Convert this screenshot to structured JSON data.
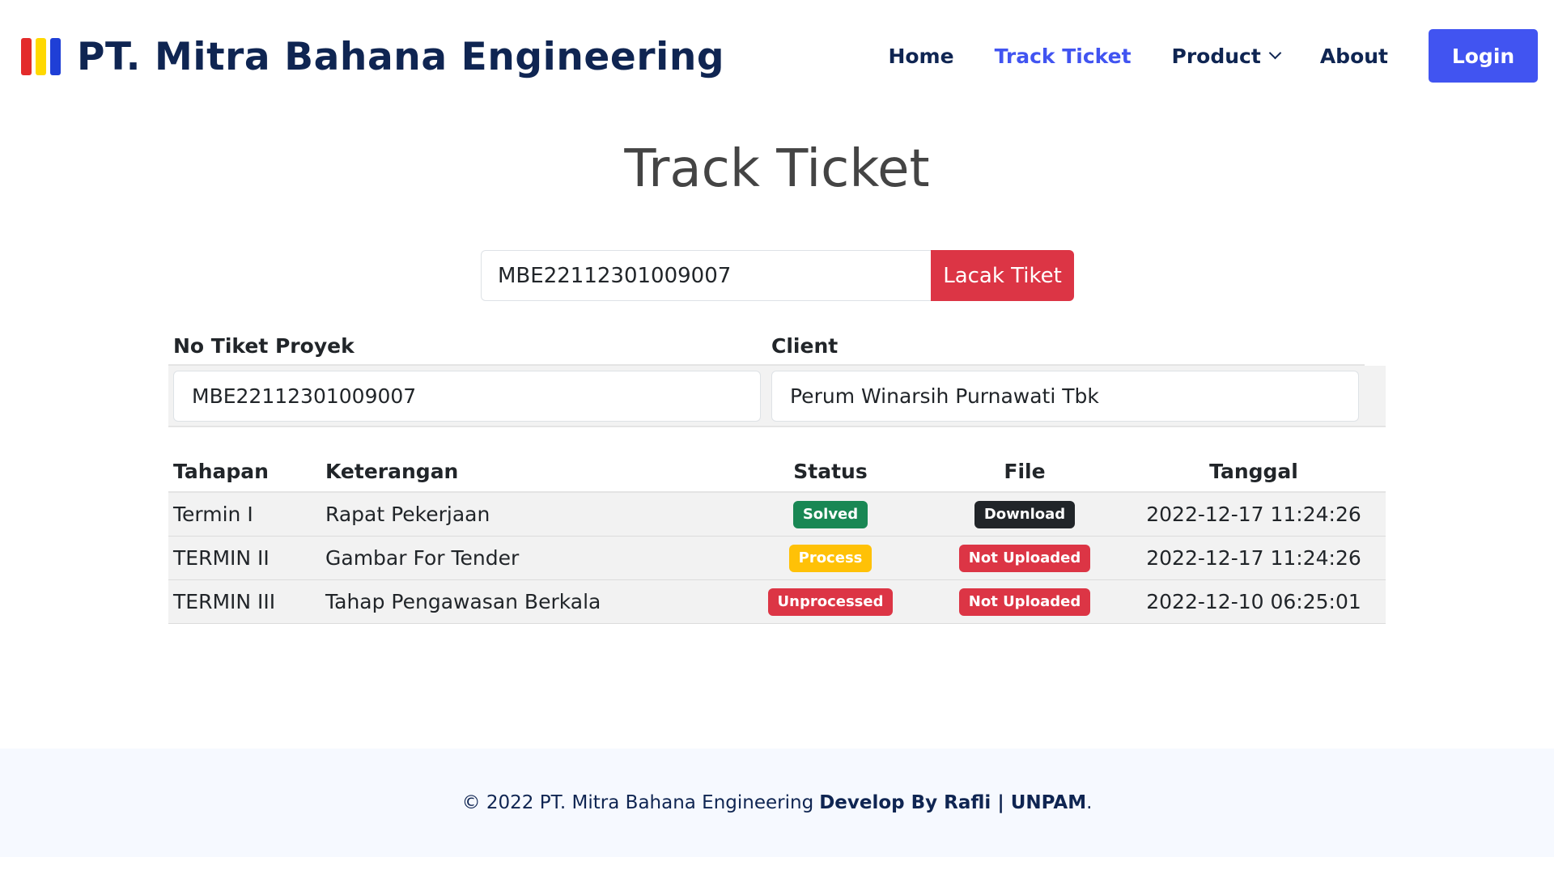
{
  "header": {
    "brand": "PT. Mitra Bahana Engineering",
    "logo_colors": [
      "#e32b2b",
      "#ffd800",
      "#1f3fd6"
    ],
    "nav": {
      "home": "Home",
      "track": "Track Ticket",
      "product": "Product",
      "about": "About"
    },
    "login": "Login",
    "accent": "#4154f1"
  },
  "main": {
    "title": "Track Ticket",
    "search": {
      "value": "MBE22112301009007",
      "button": "Lacak Tiket"
    },
    "info": {
      "ticket_label": "No Tiket Proyek",
      "client_label": "Client",
      "ticket_value": "MBE22112301009007",
      "client_value": "Perum Winarsih Purnawati Tbk"
    },
    "stages": {
      "headers": [
        "Tahapan",
        "Keterangan",
        "Status",
        "File",
        "Tanggal"
      ],
      "rows": [
        {
          "stage": "Termin I",
          "desc": "Rapat Pekerjaan",
          "status": "Solved",
          "file": "Download",
          "date": "2022-12-17 11:24:26"
        },
        {
          "stage": "TERMIN II",
          "desc": "Gambar For Tender",
          "status": "Process",
          "file": "Not Uploaded",
          "date": "2022-12-17 11:24:26"
        },
        {
          "stage": "TERMIN III",
          "desc": "Tahap Pengawasan Berkala",
          "status": "Unprocessed",
          "file": "Not Uploaded",
          "date": "2022-12-10 06:25:01"
        }
      ]
    }
  },
  "footer": {
    "copyright": "© 2022 PT. Mitra Bahana Engineering",
    "credit": "Develop By Rafli | UNPAM",
    "period": "."
  }
}
